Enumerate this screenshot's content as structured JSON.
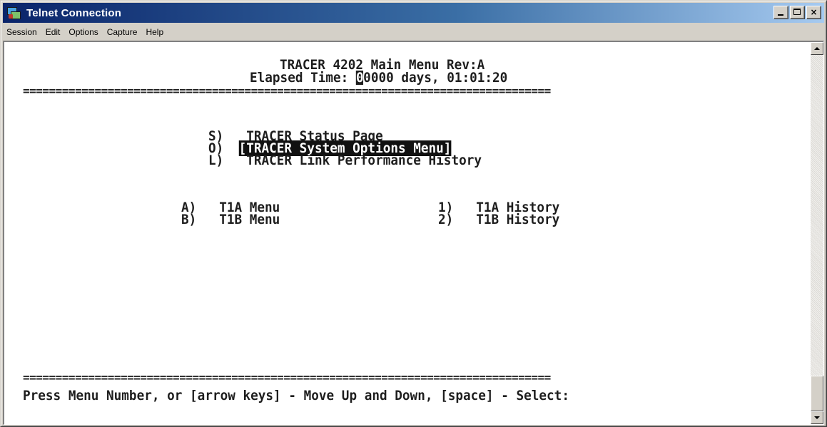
{
  "window": {
    "title": "Telnet Connection",
    "icon": "telnet-app-icon",
    "controls": [
      "minimize-icon",
      "maximize-icon",
      "close-icon"
    ],
    "close_glyph": "×"
  },
  "menubar": {
    "items": [
      "Session",
      "Edit",
      "Options",
      "Capture",
      "Help"
    ]
  },
  "terminal": {
    "header": {
      "title": "TRACER 4202 Main Menu Rev:A",
      "elapsed_label": "Elapsed Time: ",
      "elapsed_cursor_char": "0",
      "elapsed_value": "0000 days, 01:01:20"
    },
    "separator": "=================================================================================",
    "menu_items": [
      {
        "key": "S)",
        "label": "TRACER Status Page",
        "selected": false
      },
      {
        "key": "O)",
        "label": "[TRACER System Options Menu]",
        "selected": true
      },
      {
        "key": "L)",
        "label": "TRACER Link Performance History",
        "selected": false
      }
    ],
    "left_menus": [
      {
        "key": "A)",
        "label": "T1A Menu"
      },
      {
        "key": "B)",
        "label": "T1B Menu"
      }
    ],
    "right_menus": [
      {
        "key": "1)",
        "label": "T1A History"
      },
      {
        "key": "2)",
        "label": "T1B History"
      }
    ],
    "prompt": "Press Menu Number, or [arrow keys] - Move Up and Down, [space] - Select:"
  },
  "colors": {
    "titlebar_start": "#0a246a",
    "titlebar_end": "#a6caf0",
    "terminal_bg": "#ffffff",
    "terminal_fg": "#1e1e1e",
    "chrome": "#d4d0c8"
  }
}
